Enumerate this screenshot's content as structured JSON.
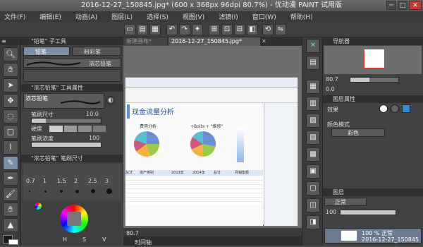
{
  "window": {
    "title": "2016-12-27_150845.jpg* (600 x 368px 96dpi 80.7%) - 优动漫 PAINT 试用版",
    "min": "─",
    "max": "□",
    "close": "✕"
  },
  "menu": [
    "文件(F)",
    "编辑(E)",
    "动画(A)",
    "图层(L)",
    "选择(S)",
    "视图(V)",
    "滤镜(I)",
    "窗口(W)",
    "帮助(H)"
  ],
  "tool_panel": {
    "sub_tool_title": "\"铅笔\" 子工具",
    "tab_pencil": "铅笔",
    "tab_pastel": "粉彩笔",
    "preset_name": "浓芯铅笔",
    "prop_title": "\"浓芯铅笔\" 工具属性",
    "prop_brush_label": "浓芯铅笔",
    "brush_size_label": "笔刷尺寸",
    "brush_size_value": "10.0",
    "hardness_label": "硬度",
    "density_label": "笔刷浓度",
    "density_value": "100",
    "density_level": 1.0,
    "size_panel_title": "\"浓芯铅笔\" 笔刷尺寸",
    "brush_sizes": [
      "0.7",
      "1",
      "1.5",
      "2",
      "2.5",
      "3"
    ],
    "color_labels": {
      "h": "H",
      "s": "S",
      "v": "V"
    }
  },
  "canvas": {
    "tab_new": "新建画布*",
    "tab_active": "2016-12-27_150845.jpg*",
    "zoom": "80.7",
    "timeline_label": "时间轴",
    "inner": {
      "heading": "现金流量分析",
      "chart1_title": "费用分析",
      "chart2_title": "+Bolts + \"维修\"",
      "table_cols": [
        "总计",
        "资产类别",
        "2013年",
        "2014年",
        "总计",
        "月销售额"
      ]
    }
  },
  "right_panel": {
    "nav_title": "导航器",
    "zoom_value": "80.7",
    "angle_value": "0.0",
    "layer_prop_title": "图层属性",
    "effect_label": "效果",
    "color_mode_label": "颜色模式",
    "color_mode_value": "彩色",
    "layer_title": "图层",
    "blend_mode": "正常",
    "opacity_value": "100",
    "layer_opacity_text": "100 % 正常",
    "layer_name": "2016-12-27_150845"
  },
  "colors": {
    "main": "#1a1a1a",
    "sub": "#ffffff",
    "accent": "#7a8fa7",
    "nav_frame": "#d63a2f"
  }
}
